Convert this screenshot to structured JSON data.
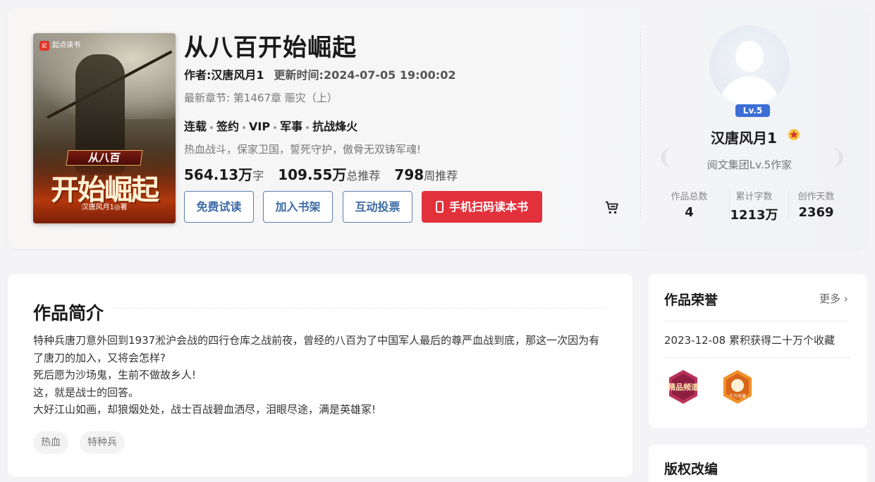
{
  "book": {
    "cover_logo_text": "起点读书",
    "cover_sub_banner": "从八百",
    "cover_title": "开始崛起",
    "cover_author_line": "汉唐风月1◎著",
    "title": "从八百开始崛起",
    "author_label": "作者:汉唐风月1",
    "update_label": "更新时间:2024-07-05 19:00:02",
    "latest_chapter": "最新章节: 第1467章 赈灾（上）",
    "tags": [
      "连载",
      "签约",
      "VIP",
      "军事",
      "抗战烽火"
    ],
    "slogan": "热血战斗，保家卫国，誓死守护，傲骨无双铸军魂!",
    "stats": {
      "words_num": "564.13万",
      "words_unit": "字",
      "total_rec_num": "109.55万",
      "total_rec_unit": "总推荐",
      "week_rec_num": "798",
      "week_rec_unit": "周推荐"
    },
    "buttons": {
      "read": "免费试读",
      "shelf": "加入书架",
      "vote": "互动投票",
      "scan": "手机扫码读本书"
    }
  },
  "author": {
    "level_badge": "Lv.5",
    "name": "汉唐风月1",
    "rank": "阅文集团Lv.5作家",
    "stats": [
      {
        "label": "作品总数",
        "value": "4"
      },
      {
        "label": "累计字数",
        "value": "1213万"
      },
      {
        "label": "创作天数",
        "value": "2369"
      }
    ]
  },
  "intro": {
    "title": "作品简介",
    "paragraphs": [
      "特种兵唐刀意外回到1937淞沪会战的四行仓库之战前夜，曾经的八百为了中国军人最后的尊严血战到底，那这一次因为有了唐刀的加入，又将会怎样?",
      "死后愿为沙场鬼，生前不做故乡人!",
      "这，就是战士的回答。",
      "大好江山如画，却狼烟处处，战士百战碧血洒尽，泪眼尽途，满是英雄冢!"
    ],
    "tags": [
      "热血",
      "特种兵"
    ]
  },
  "honor": {
    "title": "作品荣誉",
    "more": "更多",
    "item": "2023-12-08 累积获得二十万个收藏",
    "badges": [
      "精品频道",
      "千万收藏"
    ]
  },
  "copyright": {
    "title": "版权改编"
  },
  "colors": {
    "accent_red": "#e3313b",
    "link_blue": "#3e6ba5",
    "level_blue": "#3b6fd6"
  }
}
